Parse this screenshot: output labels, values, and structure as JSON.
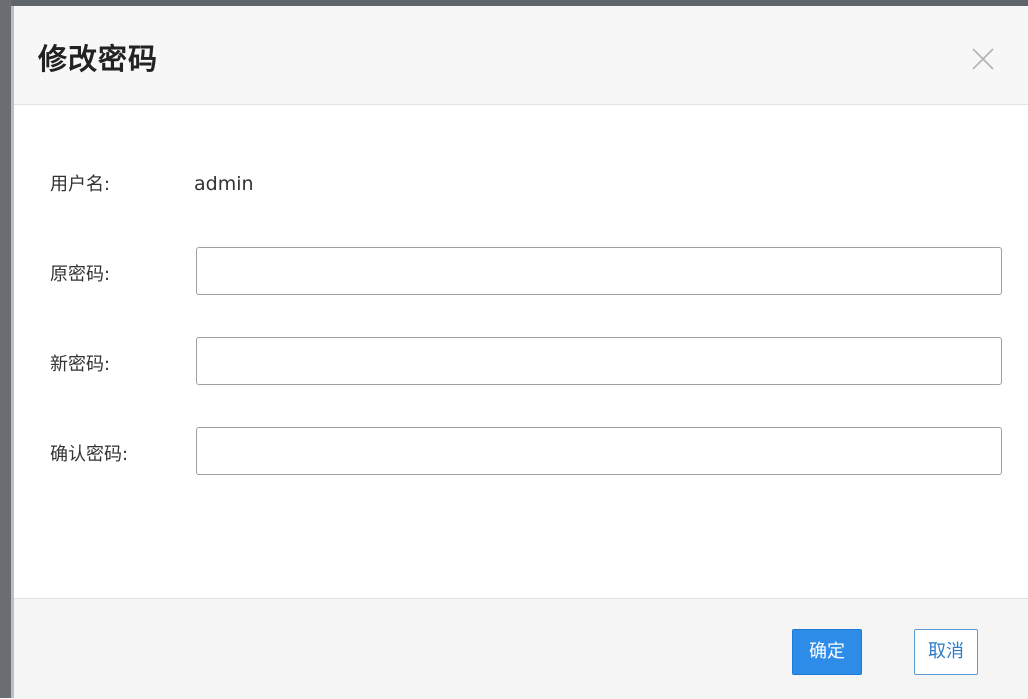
{
  "dialog": {
    "title": "修改密码",
    "close_icon": "close-icon"
  },
  "form": {
    "username": {
      "label": "用户名:",
      "value": "admin"
    },
    "old_password": {
      "label": "原密码:",
      "value": "",
      "placeholder": ""
    },
    "new_password": {
      "label": "新密码:",
      "value": "",
      "placeholder": ""
    },
    "confirm_password": {
      "label": "确认密码:",
      "value": "",
      "placeholder": ""
    }
  },
  "footer": {
    "ok_label": "确定",
    "cancel_label": "取消"
  },
  "colors": {
    "primary": "#2d8ce8",
    "cancel_border": "#5b9bd5"
  }
}
